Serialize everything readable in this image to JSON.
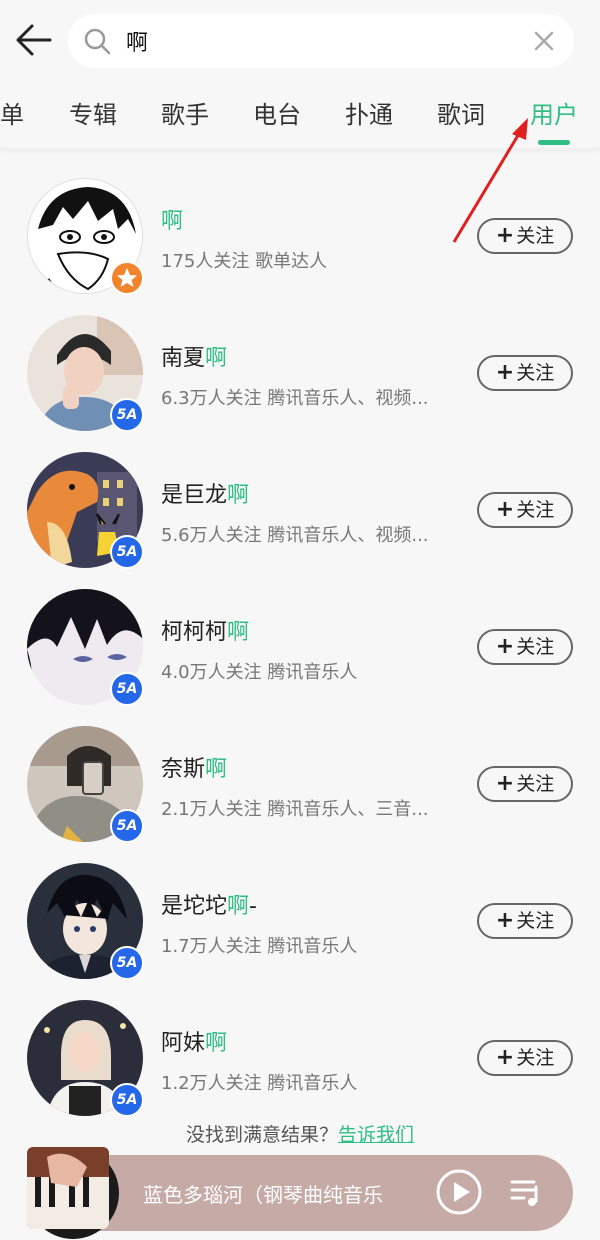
{
  "search": {
    "query": "啊",
    "placeholder": ""
  },
  "tabs": [
    {
      "label": "单"
    },
    {
      "label": "专辑"
    },
    {
      "label": "歌手"
    },
    {
      "label": "电台"
    },
    {
      "label": "扑通"
    },
    {
      "label": "歌词"
    },
    {
      "label": "用户",
      "active": true
    }
  ],
  "users": [
    {
      "name_prefix": "",
      "name_highlight": "啊",
      "name_suffix": "",
      "meta": "175人关注   歌单达人",
      "follow_label": "关注",
      "badge": "star-badge"
    },
    {
      "name_prefix": "南夏",
      "name_highlight": "啊",
      "name_suffix": "",
      "meta": "6.3万人关注   腾讯音乐人、视频...",
      "follow_label": "关注",
      "badge": "musician-badge"
    },
    {
      "name_prefix": "是巨龙",
      "name_highlight": "啊",
      "name_suffix": "",
      "meta": "5.6万人关注   腾讯音乐人、视频...",
      "follow_label": "关注",
      "badge": "musician-badge"
    },
    {
      "name_prefix": "柯柯柯",
      "name_highlight": "啊",
      "name_suffix": "",
      "meta": "4.0万人关注   腾讯音乐人",
      "follow_label": "关注",
      "badge": "musician-badge"
    },
    {
      "name_prefix": "奈斯",
      "name_highlight": "啊",
      "name_suffix": "",
      "meta": "2.1万人关注   腾讯音乐人、三音...",
      "follow_label": "关注",
      "badge": "musician-badge"
    },
    {
      "name_prefix": "是坨坨",
      "name_highlight": "啊",
      "name_suffix": "-",
      "meta": "1.7万人关注   腾讯音乐人",
      "follow_label": "关注",
      "badge": "musician-badge"
    },
    {
      "name_prefix": "阿妹",
      "name_highlight": "啊",
      "name_suffix": "",
      "meta": "1.2万人关注   腾讯音乐人",
      "follow_label": "关注",
      "badge": "musician-badge"
    }
  ],
  "badge_text": "5A",
  "feedback": {
    "text": "没找到满意结果？",
    "link": "告诉我们"
  },
  "player": {
    "song": "蓝色多瑙河（钢琴曲纯音乐"
  },
  "colors": {
    "accent": "#2fbe84",
    "annotation_arrow": "#e02020",
    "player_bg": "#c6aaa6",
    "badge_blue": "#2467e8",
    "badge_orange": "#f2842b"
  },
  "icons": {
    "back": "arrow-left-icon",
    "search": "search-icon",
    "clear": "close-icon",
    "play": "play-icon",
    "playlist": "playlist-icon"
  }
}
